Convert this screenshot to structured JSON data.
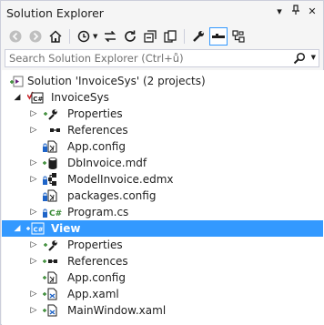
{
  "panel": {
    "title": "Solution Explorer",
    "pin_glyph": "▾",
    "autohide_glyph": "⊥",
    "close_glyph": "✕"
  },
  "toolbar": {
    "items": [
      "back-icon",
      "forward-icon",
      "home-icon",
      "sync-icon",
      "refresh-icon",
      "collapse-all-icon",
      "show-all-files-icon",
      "properties-icon",
      "preview-selected-icon",
      "class-view-icon"
    ]
  },
  "search": {
    "placeholder": "Search Solution Explorer (Ctrl+ů)"
  },
  "tree": {
    "solution": {
      "label": "Solution 'InvoiceSys' (2 projects)"
    },
    "project1": {
      "label": "InvoiceSys",
      "items": [
        {
          "label": "Properties"
        },
        {
          "label": "References"
        },
        {
          "label": "App.config"
        },
        {
          "label": "DbInvoice.mdf"
        },
        {
          "label": "ModelInvoice.edmx"
        },
        {
          "label": "packages.config"
        },
        {
          "label": "Program.cs"
        }
      ]
    },
    "project2": {
      "label": "View",
      "items": [
        {
          "label": "Properties"
        },
        {
          "label": "References"
        },
        {
          "label": "App.config"
        },
        {
          "label": "App.xaml"
        },
        {
          "label": "MainWindow.xaml"
        }
      ]
    }
  },
  "colors": {
    "selection": "#3399ff",
    "accent_blue": "#1e64c8",
    "add_green": "#388a34",
    "warning_red": "#c8252b",
    "csharp_green": "#388a34"
  }
}
